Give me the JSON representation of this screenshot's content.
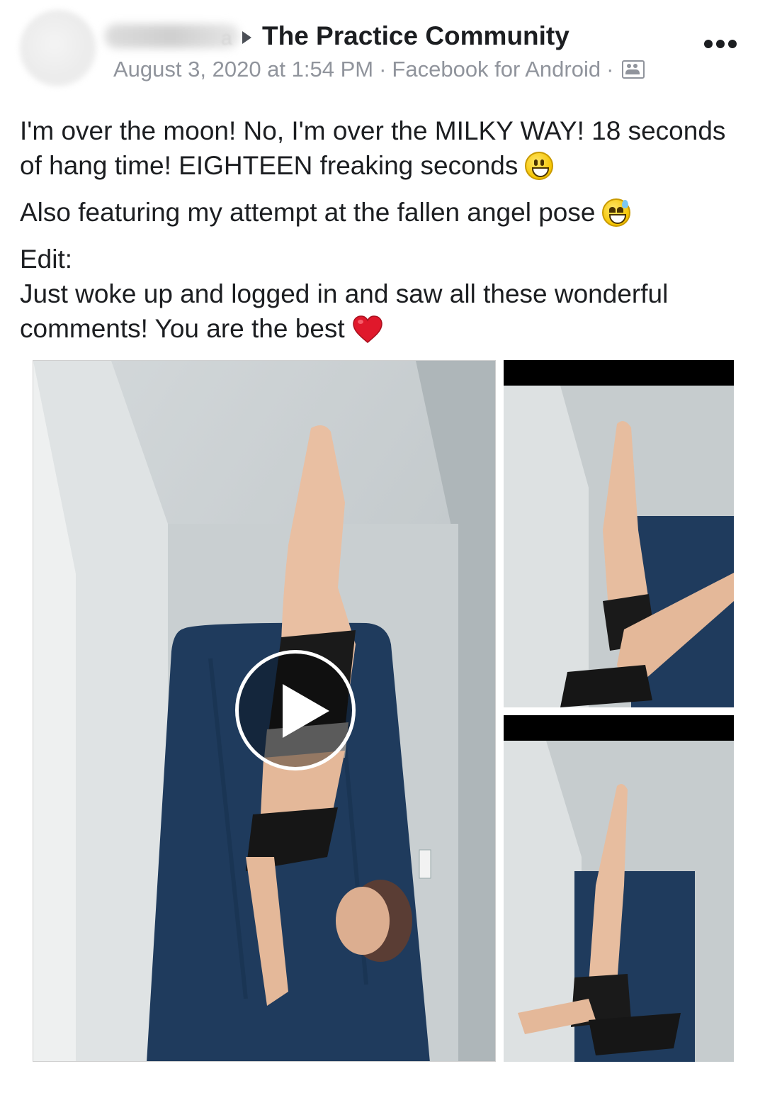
{
  "post": {
    "author_blur_tail": "a",
    "group_name": "The Practice Community",
    "date": "August 3, 2020 at 1:54 PM",
    "separator": "·",
    "source": "Facebook for Android",
    "text": {
      "line1": "I'm over the moon! No, I'm over the MILKY WAY! 18 seconds of hang time! EIGHTEEN freaking seconds",
      "line2": "Also featuring my attempt at the fallen angel pose",
      "line3a": "Edit:",
      "line3b": "Just woke up and logged in and saw all these wonderful comments! You are the best"
    }
  },
  "icons": {
    "more": "more-options-icon",
    "arrow": "caret-right-icon",
    "audience": "group-audience-icon",
    "emoji1": "grinning-face-emoji",
    "emoji2": "grinning-sweat-emoji",
    "emoji3": "red-heart-emoji",
    "play": "play-icon"
  },
  "colors": {
    "text": "#1c1e21",
    "meta": "#90949c",
    "mattress": "#1e3a5a",
    "wall": "#c3cacc"
  },
  "media": {
    "main_description_type": "video",
    "side_items": 2
  }
}
